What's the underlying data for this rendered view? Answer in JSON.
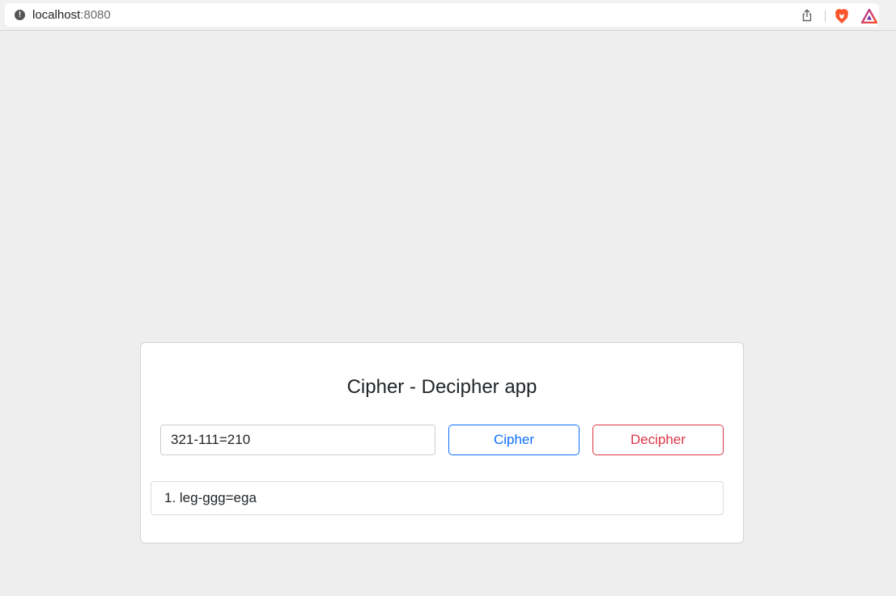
{
  "browser": {
    "url_host": "localhost",
    "url_port": ":8080"
  },
  "app": {
    "title": "Cipher - Decipher app",
    "input_value": "321-111=210",
    "cipher_label": "Cipher",
    "decipher_label": "Decipher",
    "results": [
      "1. leg-ggg=ega"
    ]
  },
  "colors": {
    "page_background": "#eeeeee",
    "cipher_button": "#0d6efd",
    "decipher_button": "#dc3545"
  },
  "icons": {
    "site_info": "info-icon",
    "share": "share-icon",
    "brave_shields": "brave-lion-icon",
    "brave_rewards": "brave-rewards-triangle-icon"
  }
}
